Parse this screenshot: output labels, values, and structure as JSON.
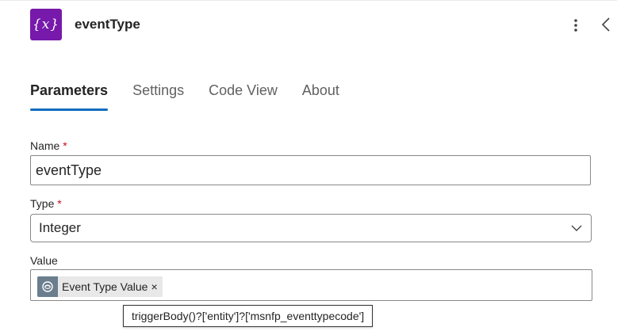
{
  "header": {
    "icon": "variable-icon",
    "icon_glyph": "{x}",
    "icon_color": "#7719aa",
    "title": "eventType",
    "more_icon": "more-vertical-icon",
    "collapse_icon": "chevron-left-icon"
  },
  "tabs": [
    {
      "label": "Parameters",
      "active": true
    },
    {
      "label": "Settings",
      "active": false
    },
    {
      "label": "Code View",
      "active": false
    },
    {
      "label": "About",
      "active": false
    }
  ],
  "accent_color": "#0f6cbd",
  "form": {
    "name": {
      "label": "Name",
      "required_mark": "*",
      "value": "eventType"
    },
    "type": {
      "label": "Type",
      "required_mark": "*",
      "value": "Integer"
    },
    "value": {
      "label": "Value",
      "token": {
        "label": "Event Type Value",
        "remove": "×",
        "icon": "dataverse-icon"
      }
    }
  },
  "tooltip": {
    "text": "triggerBody()?['entity']?['msnfp_eventtypecode']"
  }
}
